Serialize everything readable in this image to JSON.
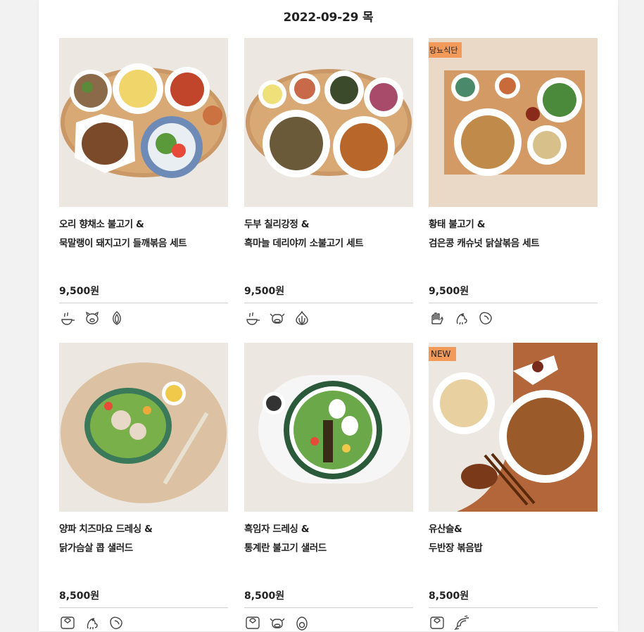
{
  "header": {
    "date": "2022-09-29 목"
  },
  "products": [
    {
      "badge": "",
      "title1": "오리 향채소 불고기 &",
      "title2": "묵말랭이 돼지고기 들깨볶음 세트",
      "price": "9,500원",
      "icons": [
        "pot-icon",
        "pig-icon",
        "onion-icon"
      ]
    },
    {
      "badge": "",
      "title1": "두부 칠리강정 &",
      "title2": "흑마늘 데리야끼 소불고기 세트",
      "price": "9,500원",
      "icons": [
        "pot-icon",
        "cow-icon",
        "garlic-icon"
      ]
    },
    {
      "badge": "당뇨식단",
      "title1": "황태 불고기 &",
      "title2": "검은콩 캐슈넛 닭살볶음 세트",
      "price": "9,500원",
      "icons": [
        "gloves-icon",
        "chicken-icon",
        "bean-icon"
      ]
    },
    {
      "badge": "",
      "title1": "양파 치즈마요 드레싱 &",
      "title2": "닭가슴살 콥 샐러드",
      "price": "8,500원",
      "icons": [
        "scale-icon",
        "chicken-icon",
        "bean-icon"
      ]
    },
    {
      "badge": "",
      "title1": "흑임자 드레싱 &",
      "title2": "통계란 불고기 샐러드",
      "price": "8,500원",
      "icons": [
        "scale-icon",
        "cow-icon",
        "egg-icon"
      ]
    },
    {
      "badge": "NEW",
      "title1": "유산슬&",
      "title2": "두반장 볶음밥",
      "price": "8,500원",
      "icons": [
        "scale-icon",
        "shrimp-icon"
      ]
    }
  ],
  "colors": {
    "badge": "#f29a5a",
    "divider": "#cfcfcf"
  }
}
